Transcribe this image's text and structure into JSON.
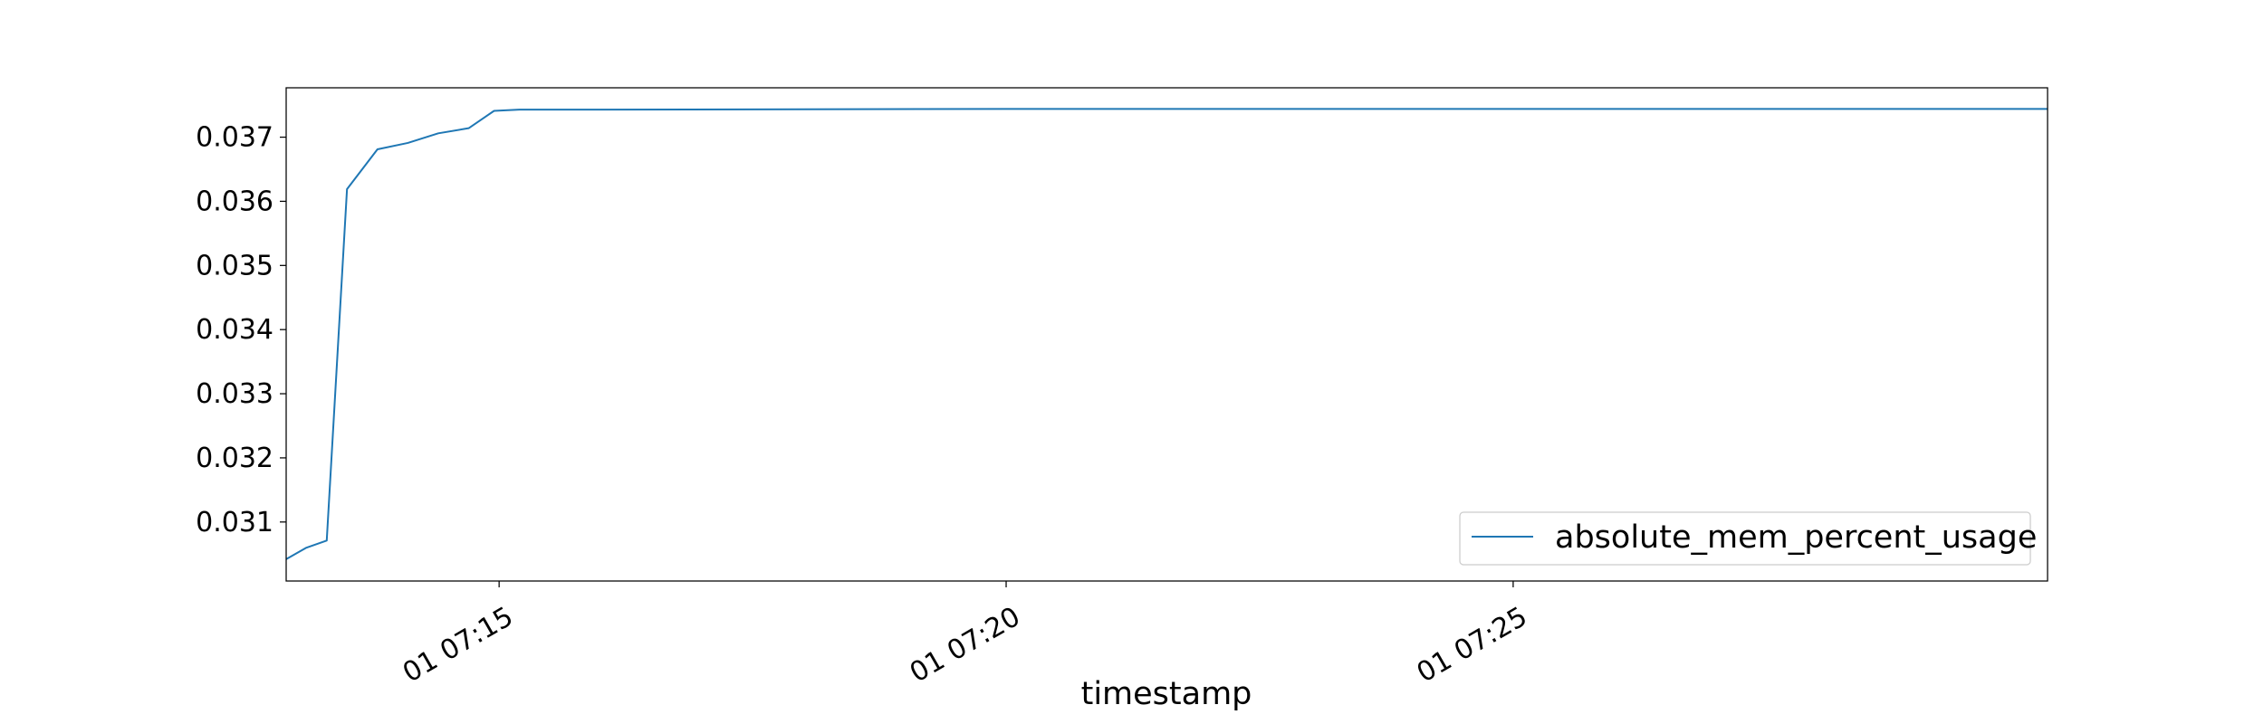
{
  "chart_data": {
    "type": "line",
    "xlabel": "timestamp",
    "ylabel": "",
    "x_unit": "minutes past 07:00 on day 01",
    "xlim": [
      12.9,
      30.27
    ],
    "ylim": [
      0.03008,
      0.03777
    ],
    "x_ticks": [
      {
        "value": 15,
        "label": "01 07:15"
      },
      {
        "value": 20,
        "label": "01 07:20"
      },
      {
        "value": 25,
        "label": "01 07:25"
      }
    ],
    "y_ticks": [
      {
        "value": 0.031,
        "label": "0.031"
      },
      {
        "value": 0.032,
        "label": "0.032"
      },
      {
        "value": 0.033,
        "label": "0.033"
      },
      {
        "value": 0.034,
        "label": "0.034"
      },
      {
        "value": 0.035,
        "label": "0.035"
      },
      {
        "value": 0.036,
        "label": "0.036"
      },
      {
        "value": 0.037,
        "label": "0.037"
      }
    ],
    "legend_position": "lower-right",
    "grid": false,
    "series": [
      {
        "name": "absolute_mem_percent_usage",
        "color": "#1f77b4",
        "x": [
          12.9,
          13.1,
          13.3,
          13.5,
          13.8,
          14.1,
          14.4,
          14.7,
          14.95,
          15.2,
          15.5,
          16.0,
          20.0,
          25.0,
          30.27
        ],
        "y": [
          0.03042,
          0.0306,
          0.03071,
          0.03619,
          0.03681,
          0.03691,
          0.03706,
          0.03714,
          0.03741,
          0.03743,
          0.03743,
          0.03743,
          0.03744,
          0.03744,
          0.03744
        ]
      }
    ]
  }
}
